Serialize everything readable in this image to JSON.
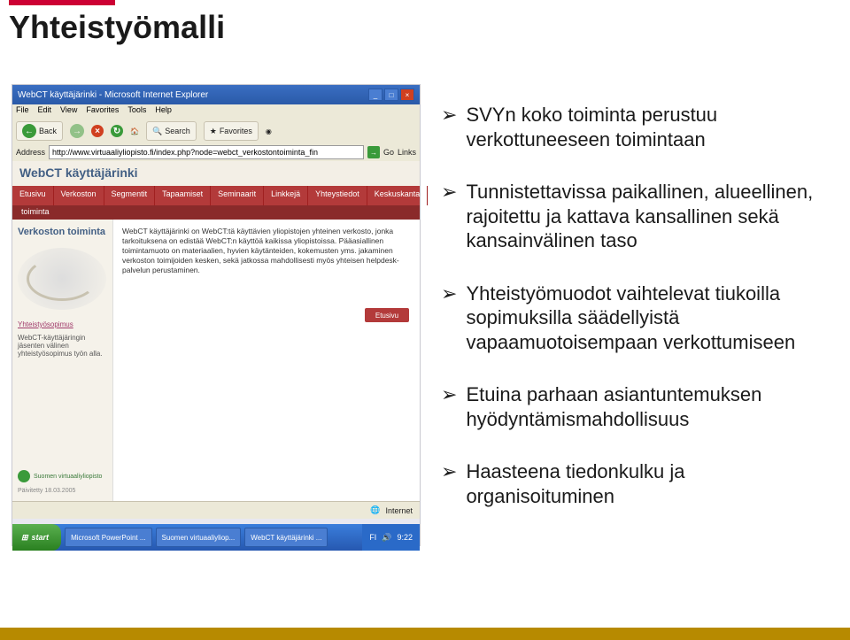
{
  "title": "Yhteistyömalli",
  "bullets": [
    "SVYn koko toiminta perustuu verkottuneeseen toimintaan",
    "Tunnistettavissa paikallinen, alueellinen, rajoitettu ja kattava kansallinen sekä kansainvälinen taso",
    "Yhteistyömuodot vaihtelevat tiukoilla sopimuksilla säädellyistä vapaamuotoisempaan verkottumiseen",
    "Etuina parhaan asiantuntemuksen hyödyntämismahdollisuus",
    "Haasteena tiedonkulku ja organisoituminen"
  ],
  "bullet_marker": "➢",
  "browser": {
    "window_title": "WebCT käyttäjärinki - Microsoft Internet Explorer",
    "menus": [
      "File",
      "Edit",
      "View",
      "Favorites",
      "Tools",
      "Help"
    ],
    "toolbar": {
      "back": "Back",
      "search": "Search",
      "favorites": "Favorites"
    },
    "address_label": "Address",
    "address_value": "http://www.virtuaaliyliopisto.fi/index.php?node=webct_verkostontoiminta_fin",
    "go_label": "Go",
    "links_label": "Links",
    "status_text": "Internet"
  },
  "webct": {
    "header": "WebCT käyttäjärinki",
    "tabs": [
      "Etusivu",
      "Verkoston",
      "Segmentit",
      "Tapaamiset",
      "Seminaarit",
      "Linkkejä",
      "Yhteystiedot",
      "Keskuskanta"
    ],
    "subtab": "toiminta",
    "side_heading": "Verkoston toiminta",
    "body_text": "WebCT käyttäjärinki on WebCT:tä käyttävien yliopistojen yhteinen verkosto, jonka tarkoituksena on edistää WebCT:n käyttöä kaikissa yliopistoissa. Pääasiallinen toimintamuoto on materiaalien, hyvien käytänteiden, kokemusten yms. jakaminen verkoston toimijoiden kesken, sekä jatkossa mahdollisesti myös yhteisen helpdesk-palvelun perustaminen.",
    "side_link1": "Yhteistyösopimus",
    "side_link2": "WebCT-käyttäjäringin jäsenten välinen yhteistyösopimus työn alla.",
    "more_btn": "Etusivu",
    "footer_logo_text": "Suomen virtuaaliyliopisto",
    "updated": "Päivitetty 18.03.2005"
  },
  "taskbar": {
    "start": "start",
    "tasks": [
      "Microsoft PowerPoint ...",
      "Suomen virtuaaliyliop...",
      "WebCT käyttäjärinki ..."
    ],
    "lang": "FI",
    "time": "9:22"
  }
}
